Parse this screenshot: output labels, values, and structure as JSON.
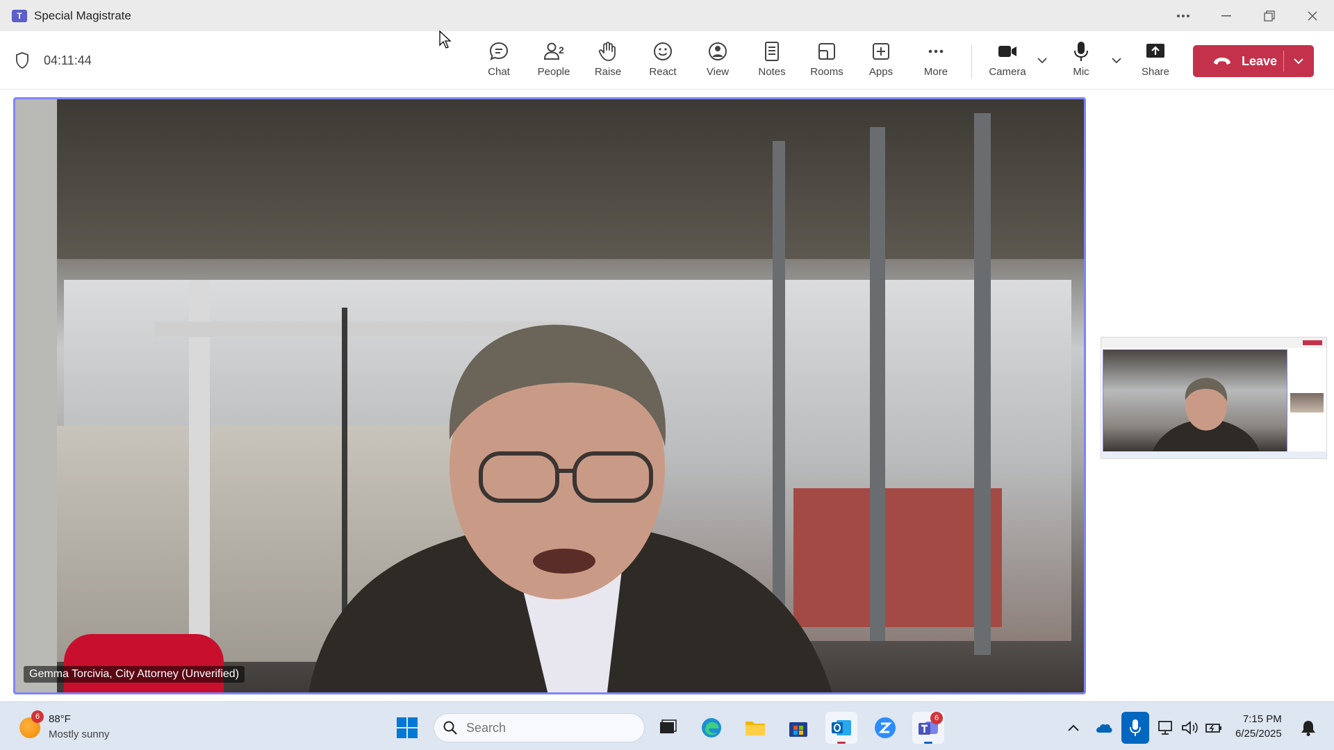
{
  "window": {
    "title": "Special Magistrate",
    "controls": [
      "More options",
      "Minimize",
      "Restore",
      "Close"
    ]
  },
  "toolbar": {
    "timer": "04:11:44",
    "items": [
      {
        "label": "Chat",
        "icon": "chat-icon"
      },
      {
        "label": "People",
        "icon": "people-icon",
        "count": "2"
      },
      {
        "label": "Raise",
        "icon": "raise-hand-icon"
      },
      {
        "label": "React",
        "icon": "react-icon"
      },
      {
        "label": "View",
        "icon": "view-icon"
      },
      {
        "label": "Notes",
        "icon": "notes-icon"
      },
      {
        "label": "Rooms",
        "icon": "rooms-icon"
      },
      {
        "label": "Apps",
        "icon": "apps-icon"
      },
      {
        "label": "More",
        "icon": "more-icon"
      }
    ],
    "media": [
      {
        "label": "Camera",
        "icon": "camera-icon"
      },
      {
        "label": "Mic",
        "icon": "mic-icon"
      },
      {
        "label": "Share",
        "icon": "share-icon"
      }
    ],
    "leave_label": "Leave",
    "leave_color": "#c4314b"
  },
  "main_video": {
    "participant_name": "Gemma Torcivia, City Attorney (Unverified)",
    "border_color": "#7f85f5"
  },
  "taskbar": {
    "weather": {
      "temperature": "88°F",
      "condition": "Mostly sunny",
      "badge": "6"
    },
    "search_placeholder": "Search",
    "apps": [
      {
        "name": "task-view-icon"
      },
      {
        "name": "edge-icon"
      },
      {
        "name": "file-explorer-icon"
      },
      {
        "name": "store-icon"
      },
      {
        "name": "outlook-icon"
      },
      {
        "name": "zoom-icon"
      },
      {
        "name": "teams-icon",
        "badge": "6"
      }
    ],
    "clock": {
      "time": "7:15 PM",
      "date": "6/25/2025"
    }
  }
}
